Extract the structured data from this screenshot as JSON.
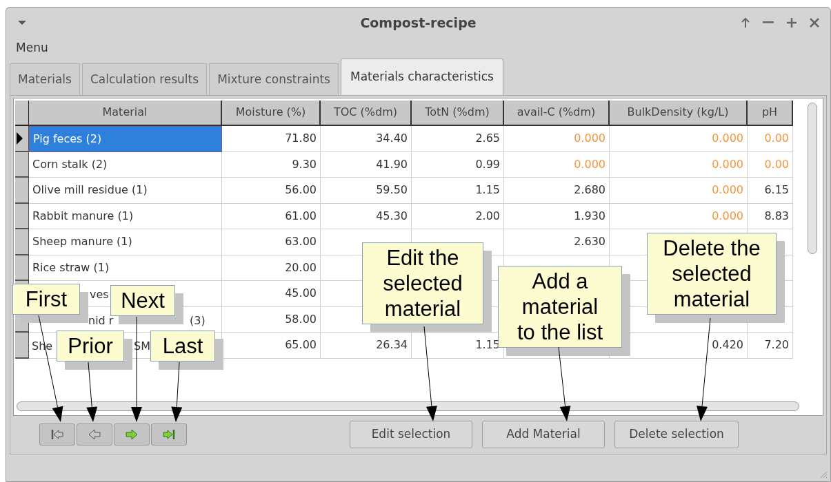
{
  "window": {
    "title": "Compost-recipe"
  },
  "menu": [
    "Menu"
  ],
  "tabs": [
    {
      "label": "Materials",
      "selected": false
    },
    {
      "label": "Calculation results",
      "selected": false
    },
    {
      "label": "Mixture constraints",
      "selected": false
    },
    {
      "label": "Materials characteristics",
      "selected": true
    }
  ],
  "table": {
    "columns": [
      "Material",
      "Moisture (%)",
      "TOC (%dm)",
      "TotN (%dm)",
      "avail-C (%dm)",
      "BulkDensity (kg/L)",
      "pH"
    ],
    "rows": [
      {
        "selected": true,
        "cells": [
          {
            "text": "Pig feces (2)"
          },
          {
            "text": "71.80",
            "warn": false
          },
          {
            "text": "34.40",
            "warn": false
          },
          {
            "text": "2.65",
            "warn": false
          },
          {
            "text": "0.000",
            "warn": true
          },
          {
            "text": "0.000",
            "warn": true
          },
          {
            "text": "0.00",
            "warn": true
          }
        ]
      },
      {
        "selected": false,
        "cells": [
          {
            "text": "Corn stalk (2)"
          },
          {
            "text": "9.30",
            "warn": false
          },
          {
            "text": "41.90",
            "warn": false
          },
          {
            "text": "0.99",
            "warn": false
          },
          {
            "text": "0.000",
            "warn": true
          },
          {
            "text": "0.000",
            "warn": true
          },
          {
            "text": "0.00",
            "warn": true
          }
        ]
      },
      {
        "selected": false,
        "cells": [
          {
            "text": "Olive mill residue (1)"
          },
          {
            "text": "56.00",
            "warn": false
          },
          {
            "text": "59.50",
            "warn": false
          },
          {
            "text": "1.15",
            "warn": false
          },
          {
            "text": "2.680",
            "warn": false
          },
          {
            "text": "0.000",
            "warn": true
          },
          {
            "text": "6.15",
            "warn": false
          }
        ]
      },
      {
        "selected": false,
        "cells": [
          {
            "text": "Rabbit manure (1)"
          },
          {
            "text": "61.00",
            "warn": false
          },
          {
            "text": "45.30",
            "warn": false
          },
          {
            "text": "2.00",
            "warn": false
          },
          {
            "text": "1.930",
            "warn": false
          },
          {
            "text": "0.000",
            "warn": true
          },
          {
            "text": "8.83",
            "warn": false
          }
        ]
      },
      {
        "selected": false,
        "cells": [
          {
            "text": "Sheep manure (1)"
          },
          {
            "text": "63.00",
            "warn": false
          },
          null,
          null,
          {
            "text": "2.630",
            "warn": false
          },
          null,
          null
        ]
      },
      {
        "selected": false,
        "cells": [
          {
            "text": "Rice straw (1)"
          },
          {
            "text": "20.00",
            "warn": false
          },
          null,
          null,
          null,
          null,
          null
        ]
      },
      {
        "selected": false,
        "cells": [
          {
            "parts": [
              "ves"
            ]
          },
          {
            "text": "45.00",
            "warn": false
          },
          null,
          null,
          null,
          null,
          null
        ]
      },
      {
        "selected": false,
        "cells": [
          {
            "parts": [
              "nid r",
              "(3)"
            ]
          },
          {
            "text": "58.00",
            "warn": false
          },
          null,
          null,
          null,
          null,
          null
        ]
      },
      {
        "selected": false,
        "cells": [
          {
            "parts": [
              "She",
              "SM"
            ]
          },
          {
            "text": "65.00",
            "warn": false
          },
          {
            "text": "26.34",
            "warn": false
          },
          {
            "text": "1.15",
            "warn": false
          },
          null,
          {
            "text": "0.420",
            "warn": false
          },
          {
            "text": "7.20",
            "warn": false
          }
        ]
      }
    ]
  },
  "navigation": [
    {
      "disabled": true
    },
    {
      "disabled": true
    },
    {
      "disabled": false
    },
    {
      "disabled": false
    }
  ],
  "buttons": [
    "Edit selection",
    "Add Material",
    "Delete selection"
  ],
  "callouts": [
    "First",
    "Prior",
    "Next",
    "Last",
    "Edit the selected material",
    "Add a material to the list",
    "Delete the selected material"
  ]
}
